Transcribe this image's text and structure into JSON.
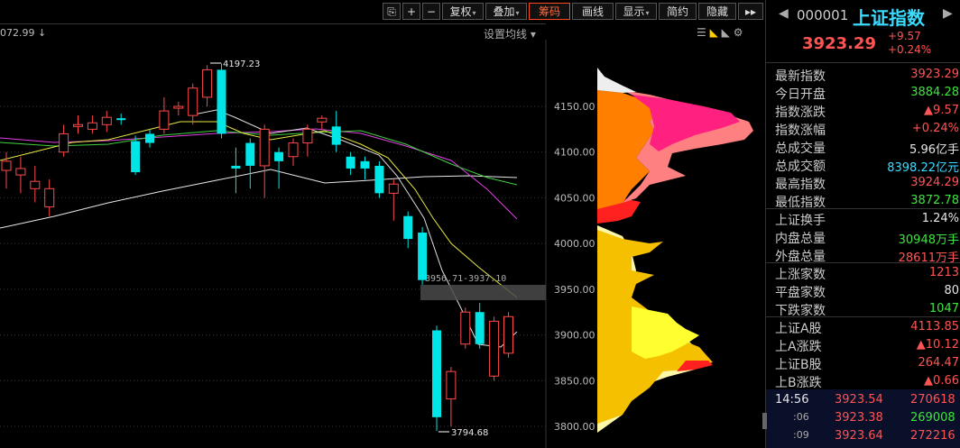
{
  "header": {
    "left_value": "072.99",
    "ma_settings_label": "设置均线"
  },
  "toolbar": {
    "buttons": [
      {
        "label": "复权",
        "active": false,
        "dropdown": true
      },
      {
        "label": "叠加",
        "active": false,
        "dropdown": true
      },
      {
        "label": "筹码",
        "active": true,
        "dropdown": false
      },
      {
        "label": "画线",
        "active": false,
        "dropdown": false
      },
      {
        "label": "显示",
        "active": false,
        "dropdown": true
      },
      {
        "label": "简约",
        "active": false,
        "dropdown": false
      },
      {
        "label": "隐藏",
        "active": false,
        "dropdown": false
      }
    ]
  },
  "chart": {
    "price_axis": [
      "4150.00",
      "4100.00",
      "4050.00",
      "4000.00",
      "3950.00",
      "3900.00",
      "3850.00",
      "3800.00"
    ],
    "high_marker": "4197.23",
    "low_marker": "3794.68",
    "range_label": "3956.71-3937.10"
  },
  "chart_data": {
    "type": "candlestick",
    "y_range": [
      3780,
      4210
    ],
    "candles": [
      {
        "o": 4080,
        "c": 4090,
        "h": 4100,
        "l": 4060,
        "up": true
      },
      {
        "o": 4075,
        "c": 4082,
        "h": 4095,
        "l": 4055,
        "up": true
      },
      {
        "o": 4060,
        "c": 4068,
        "h": 4085,
        "l": 4045,
        "up": true
      },
      {
        "o": 4040,
        "c": 4060,
        "h": 4070,
        "l": 4030,
        "up": true
      },
      {
        "o": 4100,
        "c": 4120,
        "h": 4130,
        "l": 4095,
        "up": true
      },
      {
        "o": 4128,
        "c": 4130,
        "h": 4140,
        "l": 4120,
        "up": true
      },
      {
        "o": 4125,
        "c": 4132,
        "h": 4140,
        "l": 4120,
        "up": true
      },
      {
        "o": 4130,
        "c": 4138,
        "h": 4145,
        "l": 4122,
        "up": true
      },
      {
        "o": 4137,
        "c": 4135,
        "h": 4142,
        "l": 4130,
        "up": false
      },
      {
        "o": 4112,
        "c": 4078,
        "h": 4118,
        "l": 4075,
        "up": false
      },
      {
        "o": 4120,
        "c": 4110,
        "h": 4125,
        "l": 4105,
        "up": false
      },
      {
        "o": 4125,
        "c": 4145,
        "h": 4160,
        "l": 4120,
        "up": true
      },
      {
        "o": 4148,
        "c": 4150,
        "h": 4155,
        "l": 4140,
        "up": true
      },
      {
        "o": 4140,
        "c": 4170,
        "h": 4175,
        "l": 4130,
        "up": true
      },
      {
        "o": 4160,
        "c": 4190,
        "h": 4195,
        "l": 4150,
        "up": true
      },
      {
        "o": 4120,
        "c": 4190,
        "h": 4197,
        "l": 4115,
        "up": false
      },
      {
        "o": 4085,
        "c": 4082,
        "h": 4105,
        "l": 4055,
        "up": false
      },
      {
        "o": 4110,
        "c": 4085,
        "h": 4115,
        "l": 4060,
        "up": false
      },
      {
        "o": 4085,
        "c": 4125,
        "h": 4130,
        "l": 4050,
        "up": true
      },
      {
        "o": 4100,
        "c": 4090,
        "h": 4105,
        "l": 4060,
        "up": false
      },
      {
        "o": 4095,
        "c": 4110,
        "h": 4115,
        "l": 4085,
        "up": true
      },
      {
        "o": 4110,
        "c": 4125,
        "h": 4130,
        "l": 4095,
        "up": true
      },
      {
        "o": 4133,
        "c": 4137,
        "h": 4140,
        "l": 4125,
        "up": true
      },
      {
        "o": 4128,
        "c": 4108,
        "h": 4145,
        "l": 4100,
        "up": false
      },
      {
        "o": 4095,
        "c": 4082,
        "h": 4100,
        "l": 4075,
        "up": false
      },
      {
        "o": 4082,
        "c": 4090,
        "h": 4095,
        "l": 4070,
        "up": false
      },
      {
        "o": 4085,
        "c": 4055,
        "h": 4090,
        "l": 4050,
        "up": false
      },
      {
        "o": 4055,
        "c": 4065,
        "h": 4070,
        "l": 4025,
        "up": true
      },
      {
        "o": 4030,
        "c": 4005,
        "h": 4035,
        "l": 3995,
        "up": false
      },
      {
        "o": 4012,
        "c": 3960,
        "h": 4018,
        "l": 3955,
        "up": false
      },
      {
        "o": 3905,
        "c": 3810,
        "h": 3910,
        "l": 3795,
        "up": false
      },
      {
        "o": 3830,
        "c": 3860,
        "h": 3865,
        "l": 3800,
        "up": true
      },
      {
        "o": 3890,
        "c": 3925,
        "h": 3930,
        "l": 3885,
        "up": true
      },
      {
        "o": 3925,
        "c": 3890,
        "h": 3935,
        "l": 3885,
        "up": false
      },
      {
        "o": 3855,
        "c": 3915,
        "h": 3920,
        "l": 3850,
        "up": true
      },
      {
        "o": 3880,
        "c": 3920,
        "h": 3925,
        "l": 3875,
        "up": true
      }
    ]
  },
  "panel": {
    "code": "000001",
    "name": "上证指数",
    "price": "3923.29",
    "change": "+9.57",
    "change_pct": "+0.24%",
    "rows1": [
      {
        "label": "最新指数",
        "value": "3923.29",
        "color": "red"
      },
      {
        "label": "今日开盘",
        "value": "3884.28",
        "color": "green"
      },
      {
        "label": "指数涨跌",
        "value": "▲9.57",
        "color": "red"
      },
      {
        "label": "指数涨幅",
        "value": "+0.24%",
        "color": "red"
      },
      {
        "label": "总成交量",
        "value": "5.96亿手",
        "color": "white"
      },
      {
        "label": "总成交额",
        "value": "8398.22亿元",
        "color": "cyan"
      },
      {
        "label": "最高指数",
        "value": "3924.29",
        "color": "red"
      },
      {
        "label": "最低指数",
        "value": "3872.78",
        "color": "green"
      }
    ],
    "rows2": [
      {
        "label": "上证换手",
        "value": "1.24%",
        "color": "white"
      },
      {
        "label": "内盘总量",
        "value": "30948万手",
        "color": "green"
      },
      {
        "label": "外盘总量",
        "value": "28611万手",
        "color": "red"
      }
    ],
    "rows3": [
      {
        "label": "上涨家数",
        "value": "1213",
        "color": "red"
      },
      {
        "label": "平盘家数",
        "value": "80",
        "color": "white"
      },
      {
        "label": "下跌家数",
        "value": "1047",
        "color": "green"
      }
    ],
    "rows4": [
      {
        "label": "上证A股",
        "value": "4113.85",
        "color": "red"
      },
      {
        "label": "上A涨跌",
        "value": "▲10.12",
        "color": "red"
      },
      {
        "label": "上证B股",
        "value": "264.47",
        "color": "red"
      },
      {
        "label": "上B涨跌",
        "value": "▲0.66",
        "color": "red"
      }
    ],
    "ticks": [
      {
        "time": "14:56",
        "price": "3923.54",
        "vol": "270618"
      },
      {
        "time": ":06",
        "price": "3923.38",
        "vol": "269008"
      },
      {
        "time": ":09",
        "price": "3923.64",
        "vol": "272216"
      }
    ]
  }
}
